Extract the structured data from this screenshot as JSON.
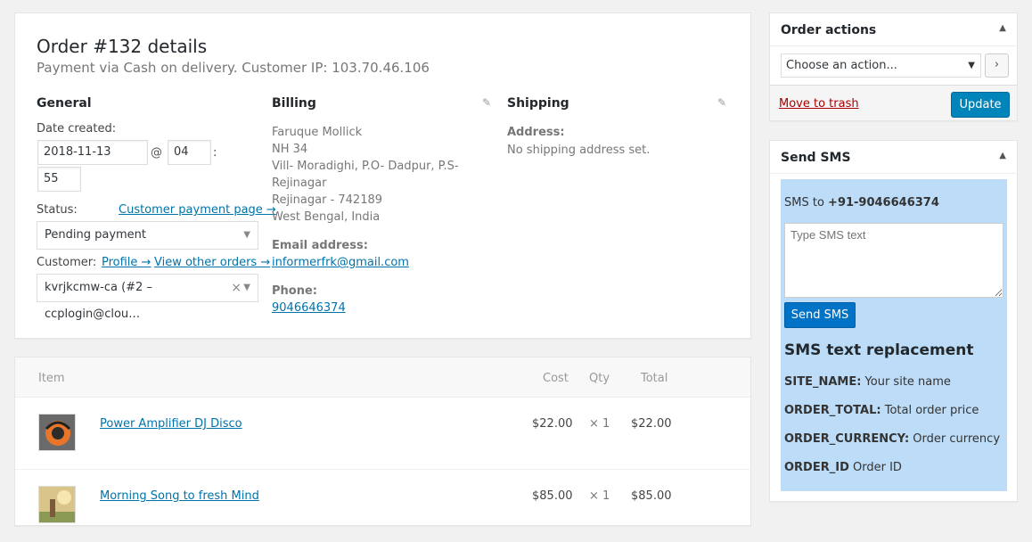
{
  "order": {
    "title": "Order #132 details",
    "subtitle": "Payment via Cash on delivery. Customer IP: 103.70.46.106"
  },
  "general": {
    "heading": "General",
    "date_label": "Date created:",
    "date_value": "2018-11-13",
    "at": "@",
    "hour": "04",
    "colon": ":",
    "minute": "55",
    "status_label": "Status:",
    "payment_link": "Customer payment page →",
    "status_value": "Pending payment",
    "customer_label": "Customer:",
    "profile_link": "Profile →",
    "orders_link": "View other orders →",
    "customer_value": "kvrjkcmw-ca (#2 – ccplogin@clou…"
  },
  "billing": {
    "heading": "Billing",
    "address_lines": [
      "Faruque Mollick",
      "NH 34",
      "Vill- Moradighi, P.O- Dadpur, P.S-",
      "Rejinagar",
      "Rejinagar - 742189",
      "West Bengal, India"
    ],
    "email_label": "Email address:",
    "email": "informerfrk@gmail.com",
    "phone_label": "Phone:",
    "phone": "9046646374"
  },
  "shipping": {
    "heading": "Shipping",
    "address_label": "Address:",
    "address_value": "No shipping address set."
  },
  "items": {
    "headers": {
      "item": "Item",
      "cost": "Cost",
      "qty": "Qty",
      "total": "Total"
    },
    "rows": [
      {
        "name": "Power Amplifier DJ Disco",
        "cost": "$22.00",
        "qty": "× 1",
        "total": "$22.00"
      },
      {
        "name": "Morning Song to fresh Mind",
        "cost": "$85.00",
        "qty": "× 1",
        "total": "$85.00"
      }
    ]
  },
  "actions": {
    "title": "Order actions",
    "select_value": "Choose an action...",
    "go": "›",
    "trash": "Move to trash",
    "update": "Update"
  },
  "sms": {
    "title": "Send SMS",
    "to_label": "SMS to",
    "to_number": "+91-9046646374",
    "placeholder": "Type SMS text",
    "send": "Send SMS",
    "replacement_heading": "SMS text replacement",
    "replacements": [
      {
        "key": "SITE_NAME:",
        "desc": "Your site name"
      },
      {
        "key": "ORDER_TOTAL:",
        "desc": "Total order price"
      },
      {
        "key": "ORDER_CURRENCY:",
        "desc": "Order currency"
      },
      {
        "key": "ORDER_ID",
        "desc": "Order ID"
      }
    ]
  },
  "colors": {
    "accent": "#0085ba",
    "sms_bg": "#bcdcf8",
    "trash": "#a00000"
  }
}
